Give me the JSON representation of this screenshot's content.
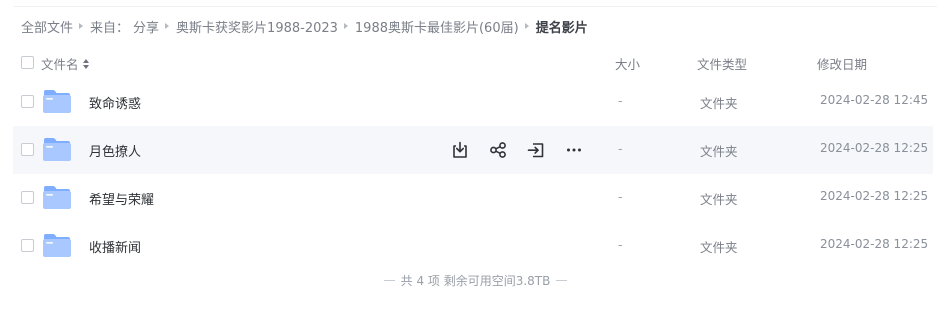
{
  "breadcrumb": {
    "items": [
      {
        "label": "全部文件",
        "prefix": ""
      },
      {
        "label": "分享",
        "prefix": "来自："
      },
      {
        "label": "奥斯卡获奖影片1988-2023",
        "prefix": ""
      },
      {
        "label": "1988奥斯卡最佳影片(60届)",
        "prefix": ""
      },
      {
        "label": "提名影片",
        "prefix": ""
      }
    ]
  },
  "table": {
    "columns": {
      "name": "文件名",
      "size": "大小",
      "type": "文件类型",
      "date": "修改日期"
    },
    "sort_icon": "sort-icon",
    "rows": [
      {
        "name": "致命诱惑",
        "size": "-",
        "type": "文件夹",
        "date": "2024-02-28 12:45",
        "icon": "folder-icon"
      },
      {
        "name": "月色撩人",
        "size": "-",
        "type": "文件夹",
        "date": "2024-02-28 12:25",
        "icon": "folder-icon"
      },
      {
        "name": "希望与荣耀",
        "size": "-",
        "type": "文件夹",
        "date": "2024-02-28 12:25",
        "icon": "folder-icon"
      },
      {
        "name": "收播新闻",
        "size": "-",
        "type": "文件夹",
        "date": "2024-02-28 12:25",
        "icon": "folder-icon"
      }
    ],
    "hover_row_actions": [
      "download-icon",
      "share-icon",
      "save-to-icon",
      "more-icon"
    ]
  },
  "footer": {
    "summary": "共 4 项 剩余可用空间3.8TB"
  },
  "colors": {
    "folder_light": "#a9c8ff",
    "folder_dark": "#7fadff",
    "hover_row": "#f5f7fb",
    "action_icon": "#2f3338"
  }
}
